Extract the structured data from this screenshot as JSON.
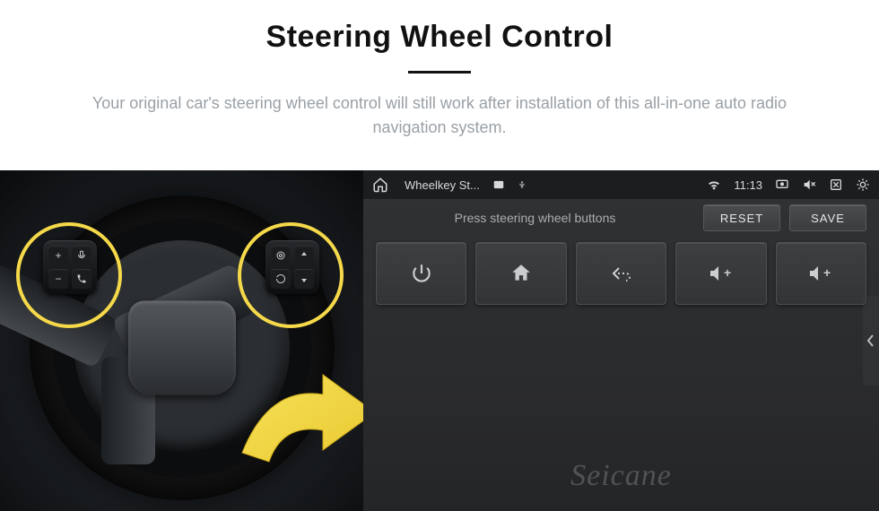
{
  "hero": {
    "title": "Steering Wheel Control",
    "subtitle": "Your original car's steering wheel control will still work after installation of this all-in-one auto radio navigation system."
  },
  "statusbar": {
    "app_title": "Wheelkey St...",
    "time": "11:13"
  },
  "subbar": {
    "prompt": "Press steering wheel buttons",
    "reset": "RESET",
    "save": "SAVE"
  },
  "tiles": {
    "power": "power",
    "home": "home",
    "back": "back",
    "vol_up_a": "volume-up",
    "vol_up_b": "volume-up"
  },
  "wheel_buttons": {
    "left": [
      "+",
      "voice",
      "−",
      "phone"
    ],
    "right": [
      "radio",
      "nav-up",
      "cycle",
      "nav-down"
    ]
  },
  "watermark": "Seicane"
}
